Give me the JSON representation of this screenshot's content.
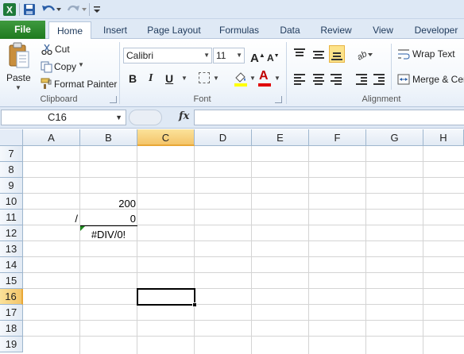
{
  "quick_access": {
    "app_icon": "excel-icon",
    "save_icon": "save-icon",
    "undo_icon": "undo-icon",
    "redo_icon": "redo-icon",
    "customize_icon": "customize-toolbar-icon"
  },
  "tabs": {
    "file": "File",
    "home": "Home",
    "insert": "Insert",
    "page_layout": "Page Layout",
    "formulas": "Formulas",
    "data": "Data",
    "review": "Review",
    "view": "View",
    "developer": "Developer"
  },
  "clipboard": {
    "group_label": "Clipboard",
    "paste": "Paste",
    "cut": "Cut",
    "copy": "Copy",
    "format_painter": "Format Painter"
  },
  "font": {
    "group_label": "Font",
    "name": "Calibri",
    "size": "11",
    "bold": "B",
    "italic": "I",
    "underline": "U",
    "font_color_glyph": "A",
    "font_color": "#e00000",
    "fill_color": "#ffff00"
  },
  "alignment": {
    "group_label": "Alignment",
    "wrap_text": "Wrap Text",
    "merge_center": "Merge & Cer"
  },
  "formula_bar": {
    "name_box": "C16",
    "fx": "fx",
    "formula": ""
  },
  "grid": {
    "columns": [
      "A",
      "B",
      "C",
      "D",
      "E",
      "F",
      "G",
      "H"
    ],
    "selected_column": "C",
    "rows": [
      "7",
      "8",
      "9",
      "10",
      "11",
      "12",
      "13",
      "14",
      "15",
      "16",
      "17",
      "18",
      "19"
    ],
    "selected_row": "16",
    "cells": {
      "B10": "200",
      "A11": "/",
      "B11": "0",
      "B12": "#DIV/0!"
    },
    "active_cell": "C16"
  },
  "colors": {
    "file_tab": "#1f7a1f",
    "selection_header": "#f4c56a",
    "error_indicator": "#1f8a1f"
  }
}
